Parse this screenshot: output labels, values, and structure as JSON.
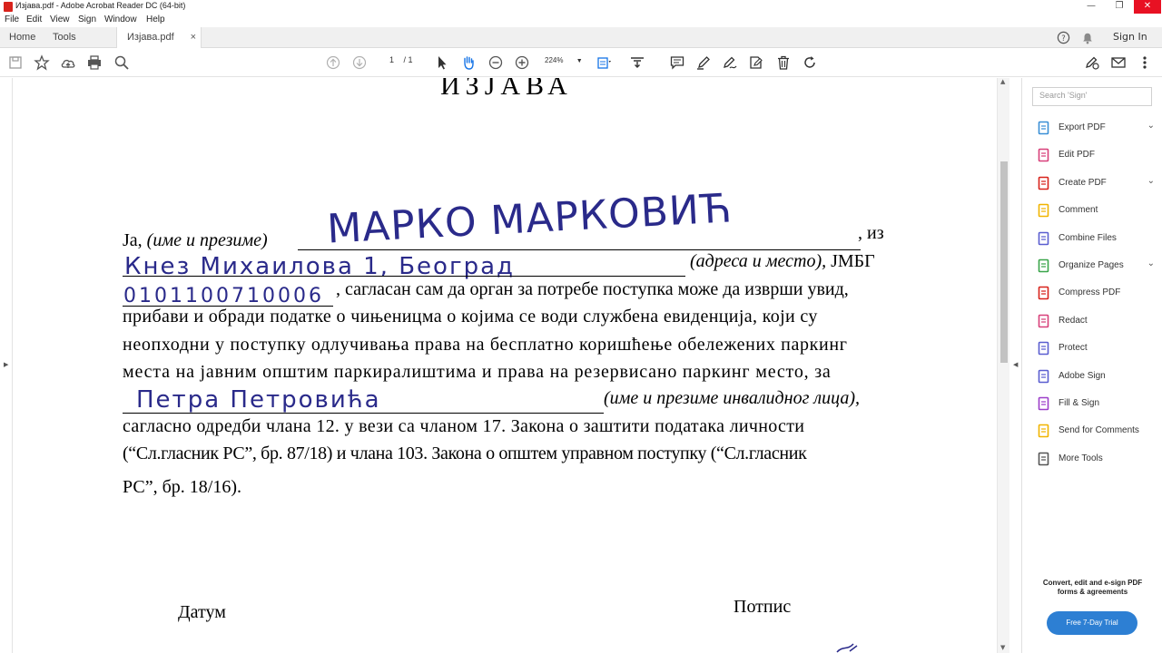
{
  "window": {
    "title": "Изјава.pdf - Adobe Acrobat Reader DC (64-bit)",
    "minimize": "—",
    "restore": "❐",
    "close": "✕"
  },
  "menu": [
    "File",
    "Edit",
    "View",
    "Sign",
    "Window",
    "Help"
  ],
  "tabs": {
    "home": "Home",
    "tools": "Tools",
    "document": "Изјава.pdf",
    "close": "×",
    "sign_in": "Sign In"
  },
  "toolbar": {
    "page_current": "1",
    "page_total": "/ 1",
    "zoom": "224%"
  },
  "document": {
    "title": "ИЗЈАВА",
    "line1_prefix": "Ја,",
    "line1_label": "(име и презиме)",
    "line1_suffix": ", из",
    "handwritten_name": "МАРКО   МАРКОВИЋ",
    "handwritten_address": "Кнез Михаилова   1,  Београд",
    "line2_label": "(адреса и место),",
    "line2_suffix": "ЈМБГ",
    "handwritten_jmbg": "0101100710006",
    "line3": ", сагласан сам да орган за потребе поступка може да изврши увид,",
    "line4": "прибави и обради податке о чињеницма о којима се води службена евиденција, који су",
    "line5": "неопходни у поступку одлучивања права на бесплатно коришћење обележених паркинг",
    "line6": "места на јавним општим паркиралиштима и права на резервисано паркинг место, за",
    "handwritten_disabled": "Петра   Петровића",
    "line7_label": "(име и презиме инвалидног лица),",
    "line8": "сагласно одредби члана 12. у вези са чланом 17. Закона о заштити података личности",
    "line9": "(“Сл.гласник РС”, бр. 87/18) и члана 103. Закона о општем управном поступку (“Сл.гласник",
    "line10": "РС”, бр. 18/16).",
    "date_label": "Датум",
    "signature_label": "Потпис"
  },
  "right_panel": {
    "search_placeholder": "Search 'Sign'",
    "tools": [
      {
        "label": "Export PDF",
        "icon": "export-pdf-icon",
        "color": "#3a8fd6",
        "chevron": true
      },
      {
        "label": "Edit PDF",
        "icon": "edit-pdf-icon",
        "color": "#d8407a",
        "chevron": false
      },
      {
        "label": "Create PDF",
        "icon": "create-pdf-icon",
        "color": "#d8231c",
        "chevron": true
      },
      {
        "label": "Comment",
        "icon": "comment-icon",
        "color": "#f1b400",
        "chevron": false
      },
      {
        "label": "Combine Files",
        "icon": "combine-files-icon",
        "color": "#5a5ed0",
        "chevron": false
      },
      {
        "label": "Organize Pages",
        "icon": "organize-pages-icon",
        "color": "#3aa54a",
        "chevron": true
      },
      {
        "label": "Compress PDF",
        "icon": "compress-pdf-icon",
        "color": "#d8231c",
        "chevron": false
      },
      {
        "label": "Redact",
        "icon": "redact-icon",
        "color": "#d8407a",
        "chevron": false
      },
      {
        "label": "Protect",
        "icon": "protect-icon",
        "color": "#5a5ed0",
        "chevron": false
      },
      {
        "label": "Adobe Sign",
        "icon": "adobe-sign-icon",
        "color": "#5a5ed0",
        "chevron": false
      },
      {
        "label": "Fill & Sign",
        "icon": "fill-sign-icon",
        "color": "#9c3fc9",
        "chevron": false
      },
      {
        "label": "Send for Comments",
        "icon": "send-for-comments-icon",
        "color": "#f1b400",
        "chevron": false
      },
      {
        "label": "More Tools",
        "icon": "more-tools-icon",
        "color": "#555555",
        "chevron": false
      }
    ],
    "promo_text": "Convert, edit and e-sign PDF forms & agreements",
    "trial_button": "Free 7-Day Trial"
  }
}
